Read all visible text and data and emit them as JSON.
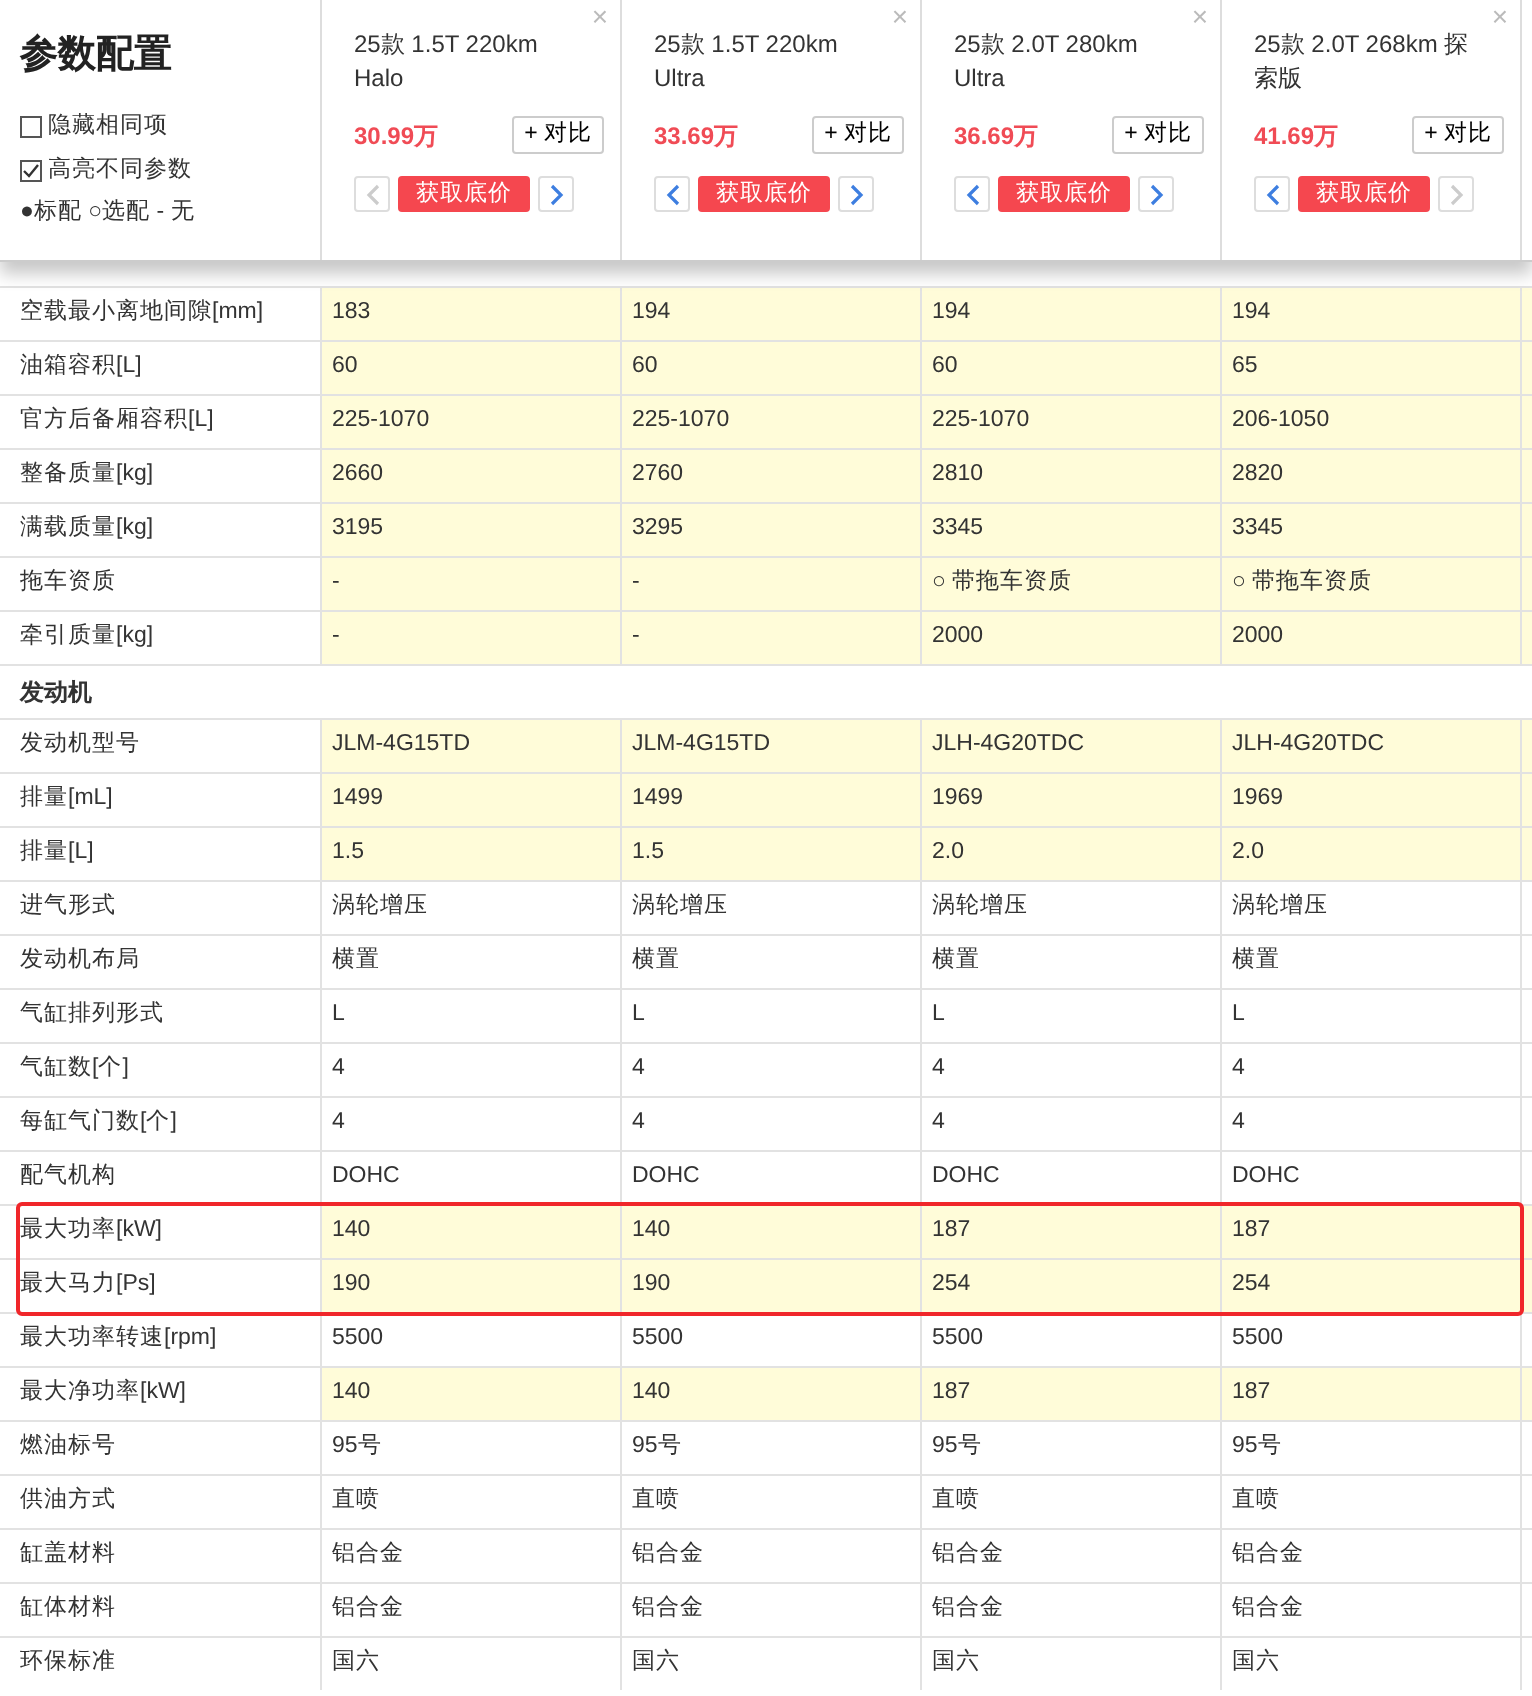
{
  "title": "参数配置",
  "options": [
    {
      "label": "隐藏相同项",
      "checked": false
    },
    {
      "label": "高亮不同参数",
      "checked": true
    }
  ],
  "legend": "●标配 ○选配 - 无",
  "cars": [
    {
      "name": "25款 1.5T 220km Halo",
      "price": "30.99万",
      "compare": "+ 对比",
      "quote": "获取底价",
      "close": "×",
      "prev_disabled": true,
      "next_disabled": false
    },
    {
      "name": "25款 1.5T 220km Ultra",
      "price": "33.69万",
      "compare": "+ 对比",
      "quote": "获取底价",
      "close": "×",
      "prev_disabled": false,
      "next_disabled": false
    },
    {
      "name": "25款 2.0T 280km Ultra",
      "price": "36.69万",
      "compare": "+ 对比",
      "quote": "获取底价",
      "close": "×",
      "prev_disabled": false,
      "next_disabled": false
    },
    {
      "name": "25款 2.0T 268km 探索版",
      "price": "41.69万",
      "compare": "+ 对比",
      "quote": "获取底价",
      "close": "×",
      "prev_disabled": false,
      "next_disabled": true
    }
  ],
  "rows": [
    {
      "kind": "param",
      "label": "空载最小离地间隙[mm]",
      "values": [
        "183",
        "194",
        "194",
        "194"
      ],
      "highlighted": true,
      "outlined": false
    },
    {
      "kind": "param",
      "label": "油箱容积[L]",
      "values": [
        "60",
        "60",
        "60",
        "65"
      ],
      "highlighted": true,
      "outlined": false
    },
    {
      "kind": "param",
      "label": "官方后备厢容积[L]",
      "values": [
        "225-1070",
        "225-1070",
        "225-1070",
        "206-1050"
      ],
      "highlighted": true,
      "outlined": false
    },
    {
      "kind": "param",
      "label": "整备质量[kg]",
      "values": [
        "2660",
        "2760",
        "2810",
        "2820"
      ],
      "highlighted": true,
      "outlined": false
    },
    {
      "kind": "param",
      "label": "满载质量[kg]",
      "values": [
        "3195",
        "3295",
        "3345",
        "3345"
      ],
      "highlighted": true,
      "outlined": false
    },
    {
      "kind": "param",
      "label": "拖车资质",
      "values": [
        "-",
        "-",
        "○ 带拖车资质",
        "○ 带拖车资质"
      ],
      "highlighted": true,
      "outlined": false
    },
    {
      "kind": "param",
      "label": "牵引质量[kg]",
      "values": [
        "-",
        "-",
        "2000",
        "2000"
      ],
      "highlighted": true,
      "outlined": false
    },
    {
      "kind": "section",
      "label": "发动机"
    },
    {
      "kind": "param",
      "label": "发动机型号",
      "values": [
        "JLM-4G15TD",
        "JLM-4G15TD",
        "JLH-4G20TDC",
        "JLH-4G20TDC"
      ],
      "highlighted": true,
      "outlined": false
    },
    {
      "kind": "param",
      "label": "排量[mL]",
      "values": [
        "1499",
        "1499",
        "1969",
        "1969"
      ],
      "highlighted": true,
      "outlined": false
    },
    {
      "kind": "param",
      "label": "排量[L]",
      "values": [
        "1.5",
        "1.5",
        "2.0",
        "2.0"
      ],
      "highlighted": true,
      "outlined": false
    },
    {
      "kind": "param",
      "label": "进气形式",
      "values": [
        "涡轮增压",
        "涡轮增压",
        "涡轮增压",
        "涡轮增压"
      ],
      "highlighted": false,
      "outlined": false
    },
    {
      "kind": "param",
      "label": "发动机布局",
      "values": [
        "横置",
        "横置",
        "横置",
        "横置"
      ],
      "highlighted": false,
      "outlined": false
    },
    {
      "kind": "param",
      "label": "气缸排列形式",
      "values": [
        "L",
        "L",
        "L",
        "L"
      ],
      "highlighted": false,
      "outlined": false
    },
    {
      "kind": "param",
      "label": "气缸数[个]",
      "values": [
        "4",
        "4",
        "4",
        "4"
      ],
      "highlighted": false,
      "outlined": false
    },
    {
      "kind": "param",
      "label": "每缸气门数[个]",
      "values": [
        "4",
        "4",
        "4",
        "4"
      ],
      "highlighted": false,
      "outlined": false
    },
    {
      "kind": "param",
      "label": "配气机构",
      "values": [
        "DOHC",
        "DOHC",
        "DOHC",
        "DOHC"
      ],
      "highlighted": false,
      "outlined": false
    },
    {
      "kind": "param",
      "label": "最大功率[kW]",
      "values": [
        "140",
        "140",
        "187",
        "187"
      ],
      "highlighted": true,
      "outlined": true
    },
    {
      "kind": "param",
      "label": "最大马力[Ps]",
      "values": [
        "190",
        "190",
        "254",
        "254"
      ],
      "highlighted": true,
      "outlined": true
    },
    {
      "kind": "param",
      "label": "最大功率转速[rpm]",
      "values": [
        "5500",
        "5500",
        "5500",
        "5500"
      ],
      "highlighted": false,
      "outlined": false
    },
    {
      "kind": "param",
      "label": "最大净功率[kW]",
      "values": [
        "140",
        "140",
        "187",
        "187"
      ],
      "highlighted": true,
      "outlined": false
    },
    {
      "kind": "param",
      "label": "燃油标号",
      "values": [
        "95号",
        "95号",
        "95号",
        "95号"
      ],
      "highlighted": false,
      "outlined": false
    },
    {
      "kind": "param",
      "label": "供油方式",
      "values": [
        "直喷",
        "直喷",
        "直喷",
        "直喷"
      ],
      "highlighted": false,
      "outlined": false
    },
    {
      "kind": "param",
      "label": "缸盖材料",
      "values": [
        "铝合金",
        "铝合金",
        "铝合金",
        "铝合金"
      ],
      "highlighted": false,
      "outlined": false
    },
    {
      "kind": "param",
      "label": "缸体材料",
      "values": [
        "铝合金",
        "铝合金",
        "铝合金",
        "铝合金"
      ],
      "highlighted": false,
      "outlined": false
    },
    {
      "kind": "param",
      "label": "环保标准",
      "values": [
        "国六",
        "国六",
        "国六",
        "国六"
      ],
      "highlighted": false,
      "outlined": false
    }
  ]
}
